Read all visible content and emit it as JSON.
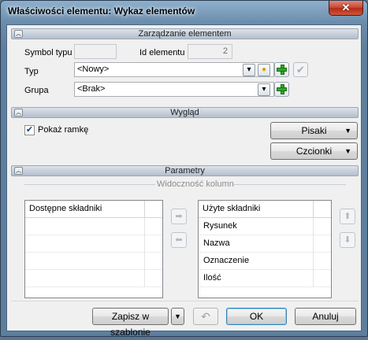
{
  "window": {
    "title": "Właściwości elementu: Wykaz elementów",
    "close_glyph": "✕"
  },
  "sections": {
    "management": "Zarządzanie elementem",
    "appearance": "Wygląd",
    "parameters": "Parametry",
    "chevron_glyph": "︽"
  },
  "management": {
    "symbol_type_label": "Symbol typu",
    "symbol_type_value": "",
    "element_id_label": "Id elementu",
    "element_id_value": "2",
    "type_label": "Typ",
    "type_value": "<Nowy>",
    "group_label": "Grupa",
    "group_value": "<Brak>",
    "type_dropdown_icon": "small-dropdown-icon",
    "type_bulb_icon": "bulb-icon",
    "add_icon": "green-plus-icon",
    "confirm_icon": "checkmark-icon",
    "confirm_glyph": "✔"
  },
  "appearance": {
    "show_frame_label": "Pokaż ramkę",
    "show_frame_checked": true,
    "check_glyph": "✔",
    "pens_button": "Pisaki",
    "fonts_button": "Czcionki",
    "dropdown_glyph": "▼"
  },
  "parameters": {
    "column_visibility_title": "Widoczność kolumn",
    "available_header": "Dostępne składniki",
    "available_items": [],
    "used_header": "Użyte składniki",
    "used_items": [
      "Rysunek",
      "Nazwa",
      "Oznaczenie",
      "Ilość"
    ],
    "move_right_glyph": "➡",
    "move_left_glyph": "⬅",
    "move_up_glyph": "⬆",
    "move_down_glyph": "⬇"
  },
  "footer": {
    "save_template": "Zapisz w szablonie",
    "dropdown_glyph": "▼",
    "undo_glyph": "↶",
    "ok": "OK",
    "cancel": "Anuluj"
  }
}
